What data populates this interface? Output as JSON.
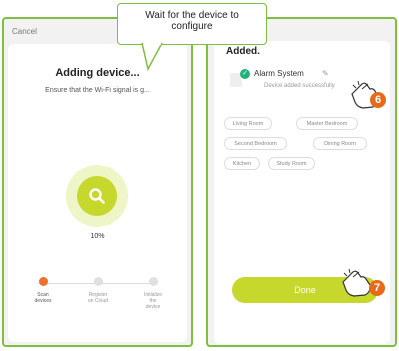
{
  "callout": {
    "text_line1": "Wait for the device to",
    "text_line2": "configure"
  },
  "left_screen": {
    "cancel": "Cancel",
    "title": "Adding device...",
    "hint": "Ensure that the Wi-Fi signal is g...",
    "percent": "10%",
    "steps": [
      {
        "label_line1": "Scan",
        "label_line2": "devices",
        "label_line3": "",
        "active": true
      },
      {
        "label_line1": "Register",
        "label_line2": "on Cloud",
        "label_line3": "",
        "active": false
      },
      {
        "label_line1": "Initialize",
        "label_line2": "the",
        "label_line3": "device",
        "active": false
      }
    ]
  },
  "right_screen": {
    "title": "Added.",
    "device_name": "Alarm System",
    "device_status": "Device added successfully",
    "rooms": [
      "Living Room",
      "Master Bedroom",
      "Second Bedroom",
      "Dining Room",
      "Kitchen",
      "Study Room"
    ],
    "done_label": "Done"
  },
  "badges": {
    "step6": "6",
    "step7": "7"
  },
  "colors": {
    "frame": "#7fbf3f",
    "accent": "#c6d82c",
    "badge": "#e76a1b",
    "active_step": "#ef6f2e",
    "check": "#20b27a"
  }
}
